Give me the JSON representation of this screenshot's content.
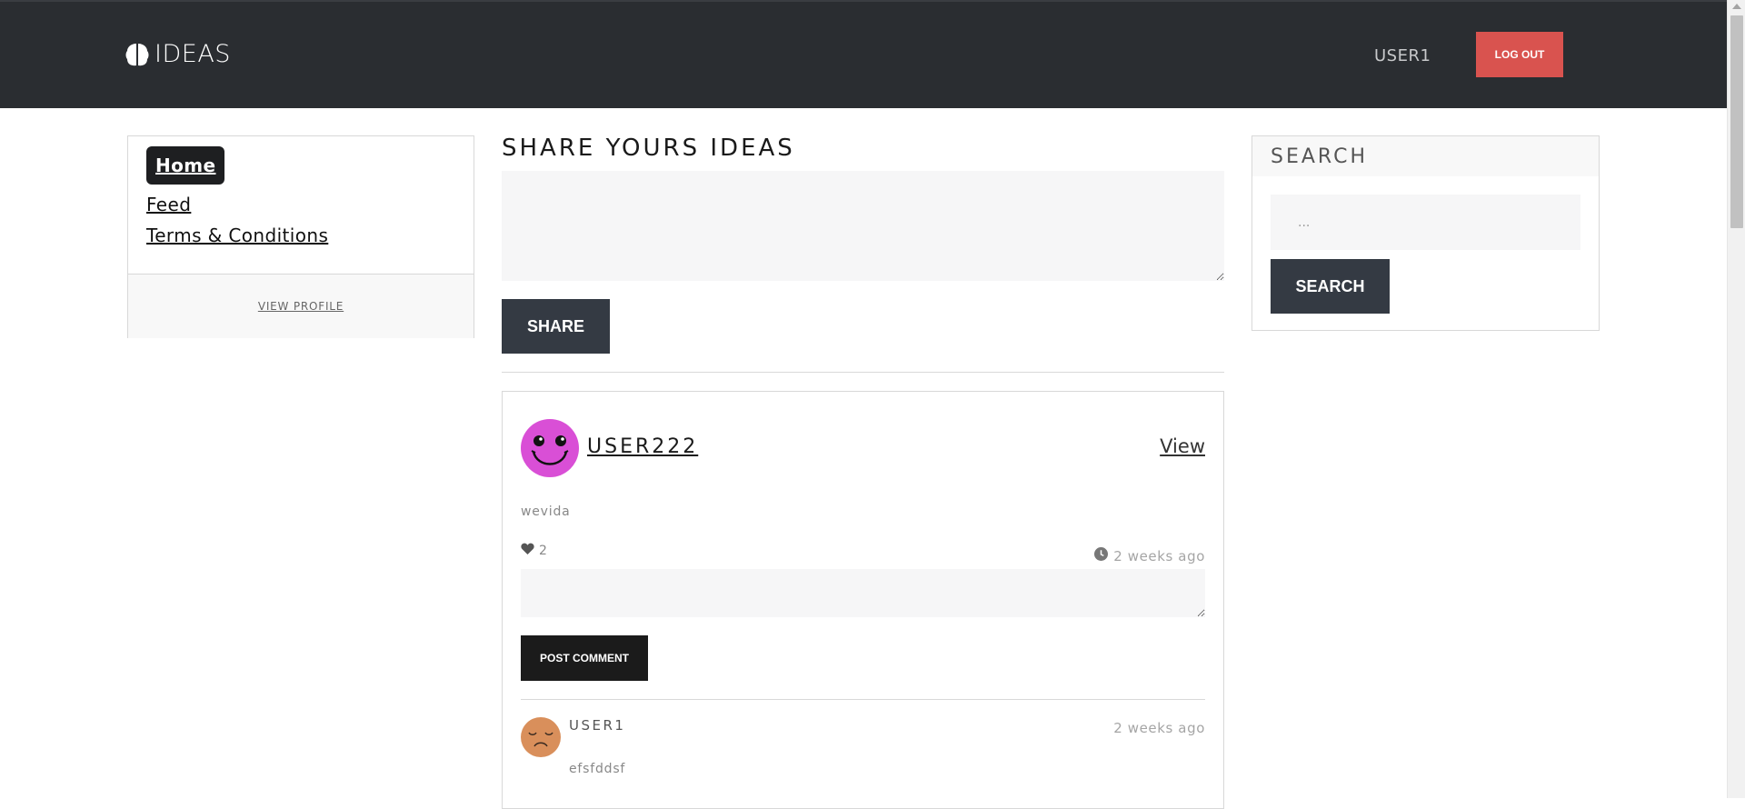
{
  "navbar": {
    "brand": "IDEAS",
    "brand_icon": "brain-icon",
    "user": "USER1",
    "logout_label": "LOG OUT",
    "background": "#2a2d31",
    "logout_color": "#d9534f"
  },
  "sidebar": {
    "items": [
      {
        "label": "Home",
        "active": true
      },
      {
        "label": "Feed",
        "active": false
      },
      {
        "label": "Terms & Conditions",
        "active": false
      }
    ],
    "view_profile": "VIEW PROFILE"
  },
  "share": {
    "title": "SHARE YOURS IDEAS",
    "button": "SHARE"
  },
  "post": {
    "author": "USER222",
    "view_label": "View",
    "body": "wevida",
    "likes": "2",
    "time": "2 weeks ago",
    "comment_button": "POST COMMENT",
    "avatar_icon": "smiley-avatar-icon",
    "avatar_color": "#d94fd6",
    "comments": [
      {
        "author": "USER1",
        "time": "2 weeks ago",
        "body": "efsfddsf",
        "avatar_icon": "sad-face-avatar-icon",
        "avatar_color": "#d98f5b"
      }
    ]
  },
  "search": {
    "title": "SEARCH",
    "placeholder": "...",
    "button": "SEARCH"
  }
}
